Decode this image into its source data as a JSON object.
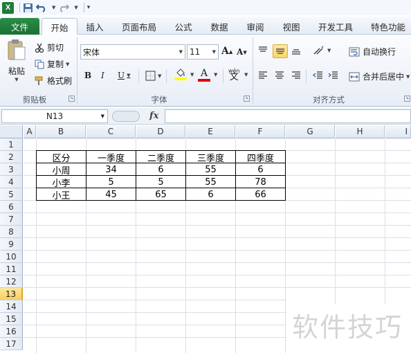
{
  "qat": {
    "logo": "X"
  },
  "tabs": [
    {
      "label": "文件"
    },
    {
      "label": "开始"
    },
    {
      "label": "插入"
    },
    {
      "label": "页面布局"
    },
    {
      "label": "公式"
    },
    {
      "label": "数据"
    },
    {
      "label": "审阅"
    },
    {
      "label": "视图"
    },
    {
      "label": "开发工具"
    },
    {
      "label": "特色功能"
    }
  ],
  "ribbon": {
    "clipboard": {
      "paste": "粘贴",
      "cut": "剪切",
      "copy": "复制",
      "format_painter": "格式刷",
      "group": "剪贴板"
    },
    "font": {
      "name": "宋体",
      "size": "11",
      "bold": "B",
      "italic": "I",
      "underline": "U",
      "group": "字体"
    },
    "align": {
      "wrap": "自动换行",
      "merge": "合并后居中",
      "group": "对齐方式"
    }
  },
  "formula_bar": {
    "name_box": "N13",
    "fx": "fx",
    "formula": ""
  },
  "grid": {
    "columns": [
      "A",
      "B",
      "C",
      "D",
      "E",
      "F",
      "G",
      "H",
      "I"
    ],
    "rows": [
      "1",
      "2",
      "3",
      "4",
      "5",
      "6",
      "7",
      "8",
      "9",
      "10",
      "11",
      "12",
      "13",
      "14",
      "15",
      "16",
      "17"
    ],
    "active_row": "13"
  },
  "table": {
    "headers": [
      "区分",
      "一季度",
      "二季度",
      "三季度",
      "四季度"
    ],
    "rows": [
      [
        "小周",
        "34",
        "6",
        "55",
        "6"
      ],
      [
        "小李",
        "5",
        "5",
        "55",
        "78"
      ],
      [
        "小王",
        "45",
        "65",
        "6",
        "66"
      ]
    ]
  },
  "watermark": "软件技巧",
  "colors": {
    "file_tab": "#1f7a3a",
    "active_row": "#f8cf5c",
    "ribbon": "#e8eef6"
  }
}
